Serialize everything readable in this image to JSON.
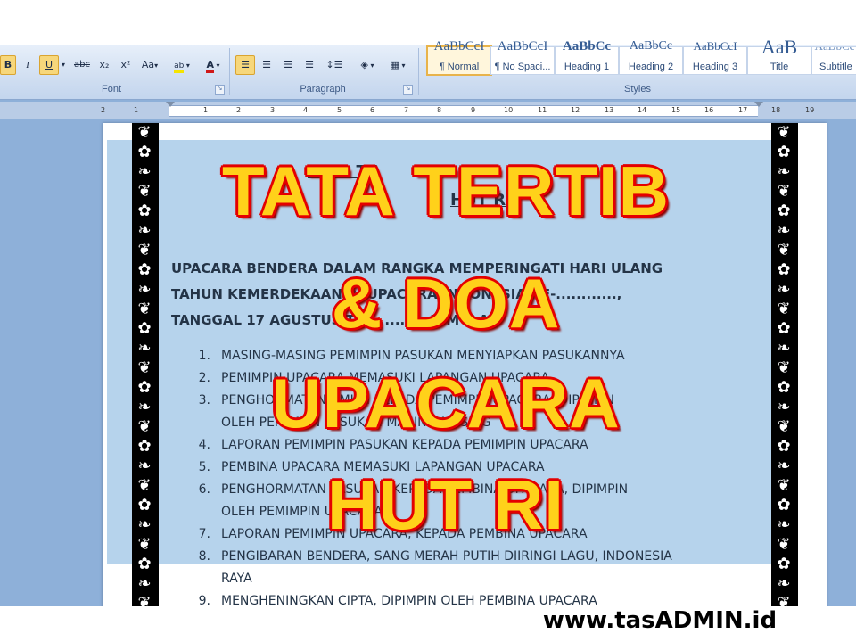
{
  "ribbon": {
    "font_group": {
      "label": "Font",
      "buttons": {
        "bold": "B",
        "italic": "I",
        "underline": "U",
        "strikethrough": "abc",
        "subscript": "x₂",
        "superscript": "x²",
        "change_case": "Aa",
        "highlight": "ab",
        "font_color": "A"
      }
    },
    "paragraph_group": {
      "label": "Paragraph"
    },
    "styles_group": {
      "label": "Styles",
      "tiles": [
        {
          "name": "¶ Normal",
          "preview": "AaBbCcI"
        },
        {
          "name": "¶ No Spaci...",
          "preview": "AaBbCcI"
        },
        {
          "name": "Heading 1",
          "preview": "AaBbCc"
        },
        {
          "name": "Heading 2",
          "preview": "AaBbCc"
        },
        {
          "name": "Heading 3",
          "preview": "AaBbCcI"
        },
        {
          "name": "Title",
          "preview": "AaB"
        },
        {
          "name": "Subtitle",
          "preview": "AaBbCc"
        }
      ]
    }
  },
  "ruler": {
    "numbers": [
      "2",
      "1",
      "1",
      "2",
      "3",
      "4",
      "5",
      "6",
      "7",
      "8",
      "9",
      "10",
      "11",
      "12",
      "13",
      "14",
      "15",
      "16",
      "17",
      "18",
      "19"
    ]
  },
  "document": {
    "title_line1": "TATA TE",
    "title_line1_tail": "R",
    "title_line2": "HUT RI",
    "intro_lines": [
      "UPACARA BENDERA DALAM RANGKA MEMPERINGATI  HARI ULANG",
      "TAHUN KEMERDEKAAN RI UPACARA INDONESIA KE-............,",
      "TANGGAL 17 AGUSTUS TA............ DIMULAI."
    ],
    "items": [
      {
        "num": "1.",
        "lines": [
          "MASING-MASING PEMIMPIN PASUKAN MENYIAPKAN PASUKANNYA"
        ]
      },
      {
        "num": "2.",
        "lines": [
          "PEMIMPIN UPACARA MEMASUKI LAPANGAN UPACARA"
        ]
      },
      {
        "num": "3.",
        "lines": [
          "PENGHORMATAN UMUM KEPADA PEMIMPIN UPACARA,  DIPIMPIN",
          "OLEH PEMIMPIN PASUKAN MASING-MASING"
        ]
      },
      {
        "num": "4.",
        "lines": [
          "LAPORAN PEMIMPIN PASUKAN KEPADA PEMIMPIN UPACARA"
        ]
      },
      {
        "num": "5.",
        "lines": [
          "PEMBINA UPACARA MEMASUKI LAPANGAN UPACARA"
        ]
      },
      {
        "num": "6.",
        "lines": [
          "PENGHORMATAN PASUKAN KEPADA PEMBINA UPACARA,  DIPIMPIN",
          "OLEH PEMIMPIN UPACARA"
        ]
      },
      {
        "num": "7.",
        "lines": [
          "LAPORAN PEMIMPIN UPACARA, KEPADA PEMBINA UPACARA"
        ]
      },
      {
        "num": "8.",
        "lines": [
          "PENGIBARAN BENDERA, SANG MERAH PUTIH DIIRINGI LAGU, INDONESIA",
          "RAYA"
        ]
      },
      {
        "num": "9.",
        "lines": [
          "MENGHENINGKAN CIPTA, DIPIMPIN OLEH  PEMBINA UPACARA"
        ]
      }
    ]
  },
  "overlay": {
    "line1": "TATA TERTIB",
    "line2": "& DOA",
    "line3": "UPACARA",
    "line4": "HUT RI"
  },
  "watermark": "www.tasADMIN.id",
  "colors": {
    "overlay_fill": "#ffd11a",
    "overlay_stroke": "#e40000",
    "highlight": "#b6d3ec",
    "ribbon": "#cddcf0"
  },
  "icons": [
    "highlight-pen-icon",
    "font-color-icon",
    "align-left-icon",
    "align-center-icon",
    "align-right-icon",
    "justify-icon",
    "line-spacing-icon",
    "shading-icon",
    "borders-icon",
    "dialog-launcher-icon",
    "floral-border-ornament"
  ]
}
